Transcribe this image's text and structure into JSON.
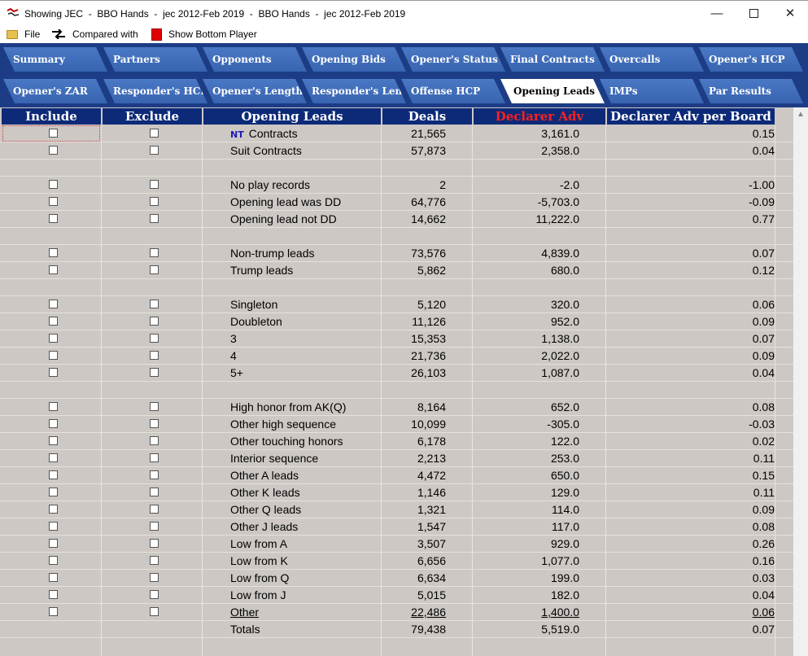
{
  "window": {
    "title": "Showing JEC  -  BBO Hands  -  jec 2012-Feb 2019  -  BBO Hands  -  jec 2012-Feb 2019",
    "min_glyph": "—",
    "close_glyph": "✕"
  },
  "menu": {
    "file": "File",
    "compared_with": "Compared with",
    "show_bottom": "Show Bottom Player"
  },
  "tabs_row1": [
    "Summary",
    "Partners",
    "Opponents",
    "Opening Bids",
    "Opener's Status",
    "Final Contracts",
    "Overcalls",
    "Opener's HCP"
  ],
  "tabs_row2": [
    "Opener's ZAR",
    "Responder's HCP",
    "Opener's Length",
    "Responder's Length",
    "Offense HCP",
    "Opening Leads",
    "IMPs",
    "Par Results"
  ],
  "active_tab": "Opening Leads",
  "columns": {
    "include": "Include",
    "exclude": "Exclude",
    "opening_leads": "Opening Leads",
    "deals": "Deals",
    "declarer_adv": "Declarer Adv",
    "declarer_adv_per_board": "Declarer Adv per Board"
  },
  "colors": {
    "tab_bg": "#3864b0",
    "tabbar_bg": "#1d3c86",
    "header_bg": "#0d2a78",
    "grid_bg": "#cdc8c4",
    "declarer_adv_header": "#ff2020"
  },
  "rows": [
    {
      "prefix": "NT",
      "label": "Contracts",
      "deals": "21,565",
      "adv": "3,161.0",
      "per": "0.15",
      "checkboxes": true
    },
    {
      "label": "Suit Contracts",
      "deals": "57,873",
      "adv": "2,358.0",
      "per": "0.04",
      "checkboxes": true
    },
    {
      "blank": true
    },
    {
      "label": "No play records",
      "deals": "2",
      "adv": "-2.0",
      "per": "-1.00",
      "checkboxes": true
    },
    {
      "label": "Opening lead was DD",
      "deals": "64,776",
      "adv": "-5,703.0",
      "per": "-0.09",
      "checkboxes": true
    },
    {
      "label": "Opening lead not DD",
      "deals": "14,662",
      "adv": "11,222.0",
      "per": "0.77",
      "checkboxes": true
    },
    {
      "blank": true
    },
    {
      "label": "Non-trump leads",
      "deals": "73,576",
      "adv": "4,839.0",
      "per": "0.07",
      "checkboxes": true
    },
    {
      "label": "Trump leads",
      "deals": "5,862",
      "adv": "680.0",
      "per": "0.12",
      "checkboxes": true
    },
    {
      "blank": true
    },
    {
      "label": "Singleton",
      "deals": "5,120",
      "adv": "320.0",
      "per": "0.06",
      "checkboxes": true
    },
    {
      "label": "Doubleton",
      "deals": "11,126",
      "adv": "952.0",
      "per": "0.09",
      "checkboxes": true
    },
    {
      "label": "3",
      "deals": "15,353",
      "adv": "1,138.0",
      "per": "0.07",
      "checkboxes": true
    },
    {
      "label": "4",
      "deals": "21,736",
      "adv": "2,022.0",
      "per": "0.09",
      "checkboxes": true
    },
    {
      "label": "5+",
      "deals": "26,103",
      "adv": "1,087.0",
      "per": "0.04",
      "checkboxes": true
    },
    {
      "blank": true
    },
    {
      "label": "High honor from AK(Q)",
      "deals": "8,164",
      "adv": "652.0",
      "per": "0.08",
      "checkboxes": true
    },
    {
      "label": "Other high sequence",
      "deals": "10,099",
      "adv": "-305.0",
      "per": "-0.03",
      "checkboxes": true
    },
    {
      "label": "Other touching honors",
      "deals": "6,178",
      "adv": "122.0",
      "per": "0.02",
      "checkboxes": true
    },
    {
      "label": "Interior sequence",
      "deals": "2,213",
      "adv": "253.0",
      "per": "0.11",
      "checkboxes": true
    },
    {
      "label": "Other A leads",
      "deals": "4,472",
      "adv": "650.0",
      "per": "0.15",
      "checkboxes": true
    },
    {
      "label": "Other K leads",
      "deals": "1,146",
      "adv": "129.0",
      "per": "0.11",
      "checkboxes": true
    },
    {
      "label": "Other Q leads",
      "deals": "1,321",
      "adv": "114.0",
      "per": "0.09",
      "checkboxes": true
    },
    {
      "label": "Other J leads",
      "deals": "1,547",
      "adv": "117.0",
      "per": "0.08",
      "checkboxes": true
    },
    {
      "label": "Low from A",
      "deals": "3,507",
      "adv": "929.0",
      "per": "0.26",
      "checkboxes": true
    },
    {
      "label": "Low from K",
      "deals": "6,656",
      "adv": "1,077.0",
      "per": "0.16",
      "checkboxes": true
    },
    {
      "label": "Low from Q",
      "deals": "6,634",
      "adv": "199.0",
      "per": "0.03",
      "checkboxes": true
    },
    {
      "label": "Low from J",
      "deals": "5,015",
      "adv": "182.0",
      "per": "0.04",
      "checkboxes": true
    },
    {
      "label": "Other",
      "deals": "22,486",
      "adv": "1,400.0",
      "per": "0.06",
      "checkboxes": true,
      "underline": true
    },
    {
      "label": "Totals",
      "deals": "79,438",
      "adv": "5,519.0",
      "per": "0.07",
      "checkboxes": false
    }
  ]
}
